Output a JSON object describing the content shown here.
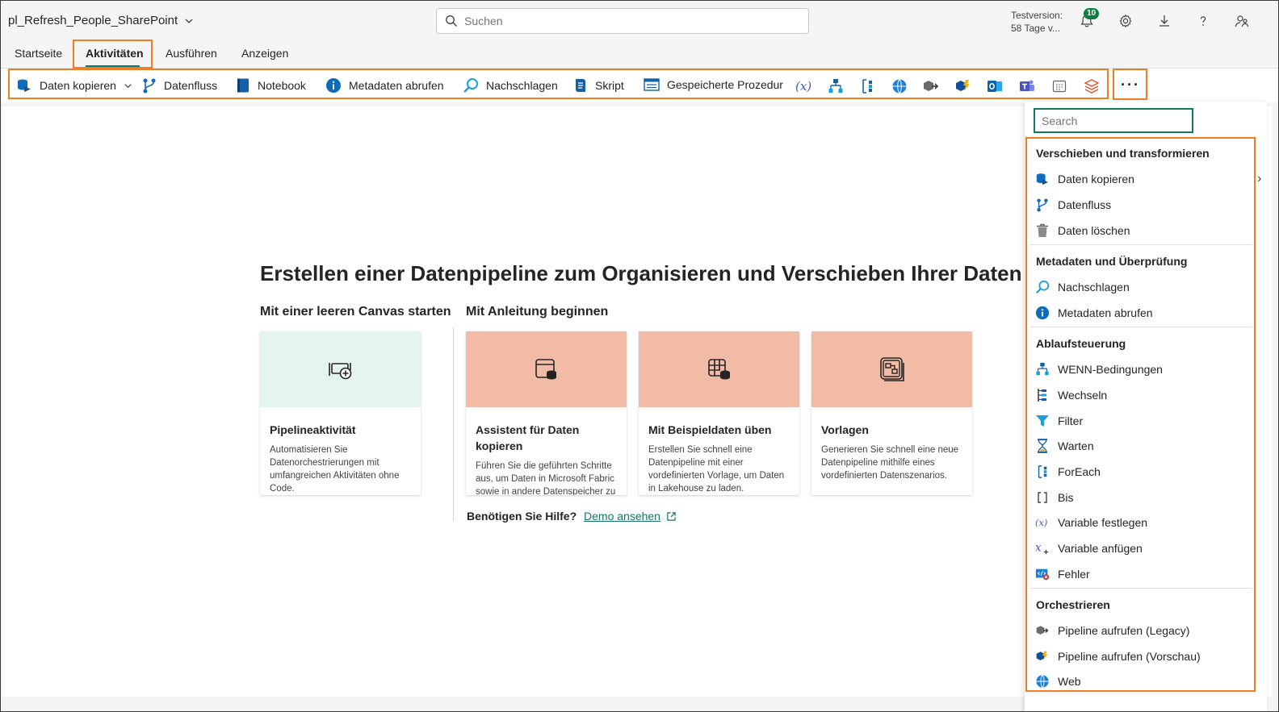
{
  "header": {
    "workspace_name": "pl_Refresh_People_SharePoint",
    "search_placeholder": "Suchen",
    "trial_line1": "Testversion:",
    "trial_line2": "58 Tage v...",
    "notification_count": "10"
  },
  "tabs": [
    {
      "label": "Startseite"
    },
    {
      "label": "Aktivitäten"
    },
    {
      "label": "Ausführen"
    },
    {
      "label": "Anzeigen"
    }
  ],
  "ribbon": {
    "copy_data": "Daten kopieren",
    "dataflow": "Datenfluss",
    "notebook": "Notebook",
    "get_metadata": "Metadaten abrufen",
    "lookup": "Nachschlagen",
    "script": "Skript",
    "stored_procedure": "Gespeicherte Prozedur",
    "more": "···"
  },
  "main": {
    "heading": "Erstellen einer Datenpipeline zum Organisieren und Verschieben Ihrer Daten",
    "start_blank": "Mit einer leeren Canvas starten",
    "start_guided": "Mit Anleitung beginnen",
    "cards": [
      {
        "title": "Pipelineaktivität",
        "desc": "Automatisieren Sie Datenorchestrierungen mit umfangreichen Aktivitäten ohne Code."
      },
      {
        "title": "Assistent für Daten kopieren",
        "desc": "Führen Sie die geführten Schritte aus, um Daten in Microsoft Fabric sowie in andere Datenspeicher zu kopieren."
      },
      {
        "title": "Mit Beispieldaten üben",
        "desc": "Erstellen Sie schnell eine Datenpipeline mit einer vordefinierten Vorlage, um Daten in Lakehouse zu laden."
      },
      {
        "title": "Vorlagen",
        "desc": "Generieren Sie schnell eine neue Datenpipeline mithilfe eines vordefinierten Datenszenarios."
      }
    ],
    "help_label": "Benötigen Sie Hilfe?",
    "help_link": "Demo ansehen"
  },
  "panel": {
    "search_placeholder": "Search",
    "sections": [
      {
        "title": "Verschieben und transformieren",
        "items": [
          "Daten kopieren",
          "Datenfluss",
          "Daten löschen"
        ]
      },
      {
        "title": "Metadaten und Überprüfung",
        "items": [
          "Nachschlagen",
          "Metadaten abrufen"
        ]
      },
      {
        "title": "Ablaufsteuerung",
        "items": [
          "WENN-Bedingungen",
          "Wechseln",
          "Filter",
          "Warten",
          "ForEach",
          "Bis",
          "Variable festlegen",
          "Variable anfügen",
          "Fehler"
        ]
      },
      {
        "title": "Orchestrieren",
        "items": [
          "Pipeline aufrufen (Legacy)",
          "Pipeline aufrufen (Vorschau)",
          "Web"
        ]
      }
    ]
  },
  "colors": {
    "accent": "#117865",
    "highlight": "#f07d23",
    "card_green": "#e3f5ee",
    "card_salmon": "#f2bba6"
  }
}
